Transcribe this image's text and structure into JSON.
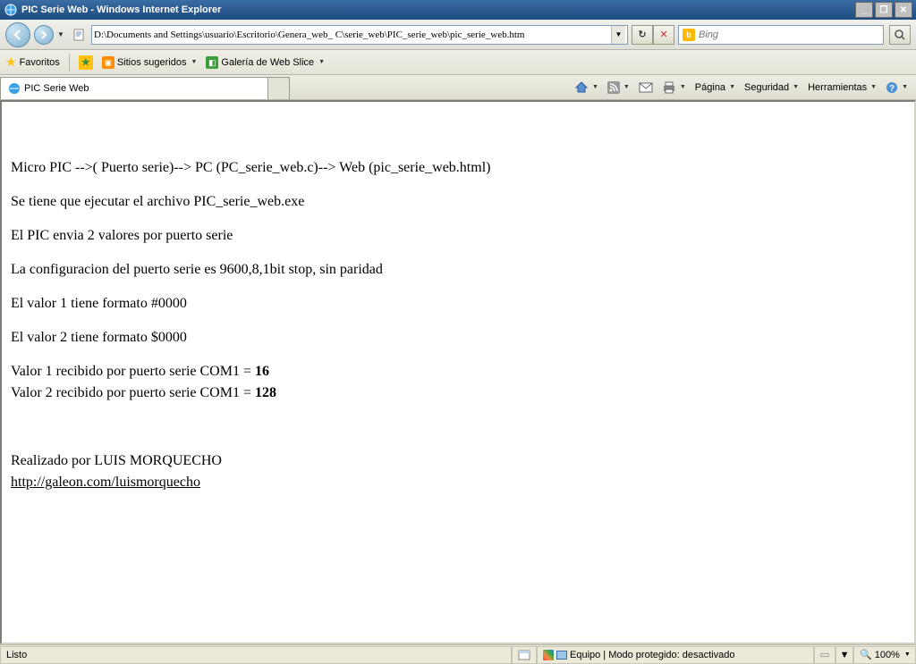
{
  "titlebar": {
    "title": "PIC Serie Web - Windows Internet Explorer"
  },
  "nav": {
    "address": "D:\\Documents and Settings\\usuario\\Escritorio\\Genera_web_ C\\serie_web\\PIC_serie_web\\pic_serie_web.htm",
    "refresh": "↻",
    "stop": "✕"
  },
  "search": {
    "placeholder": "Bing"
  },
  "favbar": {
    "favoritos": "Favoritos",
    "sitios": "Sitios sugeridos",
    "slice": "Galería de Web Slice"
  },
  "tab": {
    "title": "PIC Serie Web"
  },
  "cmd": {
    "pagina": "Página",
    "seguridad": "Seguridad",
    "herramientas": "Herramientas"
  },
  "page": {
    "p1": "Micro PIC -->( Puerto serie)--> PC (PC_serie_web.c)--> Web (pic_serie_web.html)",
    "p2": "Se tiene que ejecutar el archivo PIC_serie_web.exe",
    "p3": "El PIC envia 2 valores por puerto serie",
    "p4": "La configuracion del puerto serie es 9600,8,1bit stop, sin paridad",
    "p5": "El valor 1 tiene formato #0000",
    "p6": "El valor 2 tiene formato $0000",
    "v1_label": "Valor 1 recibido por puerto serie COM1 = ",
    "v1_value": "16",
    "v2_label": "Valor 2 recibido por puerto serie COM1 = ",
    "v2_value": "128",
    "author": "Realizado por LUIS MORQUECHO",
    "link": "http://galeon.com/luismorquecho"
  },
  "status": {
    "ready": "Listo",
    "zone": "Equipo | Modo protegido: desactivado",
    "zoom": "100%"
  }
}
